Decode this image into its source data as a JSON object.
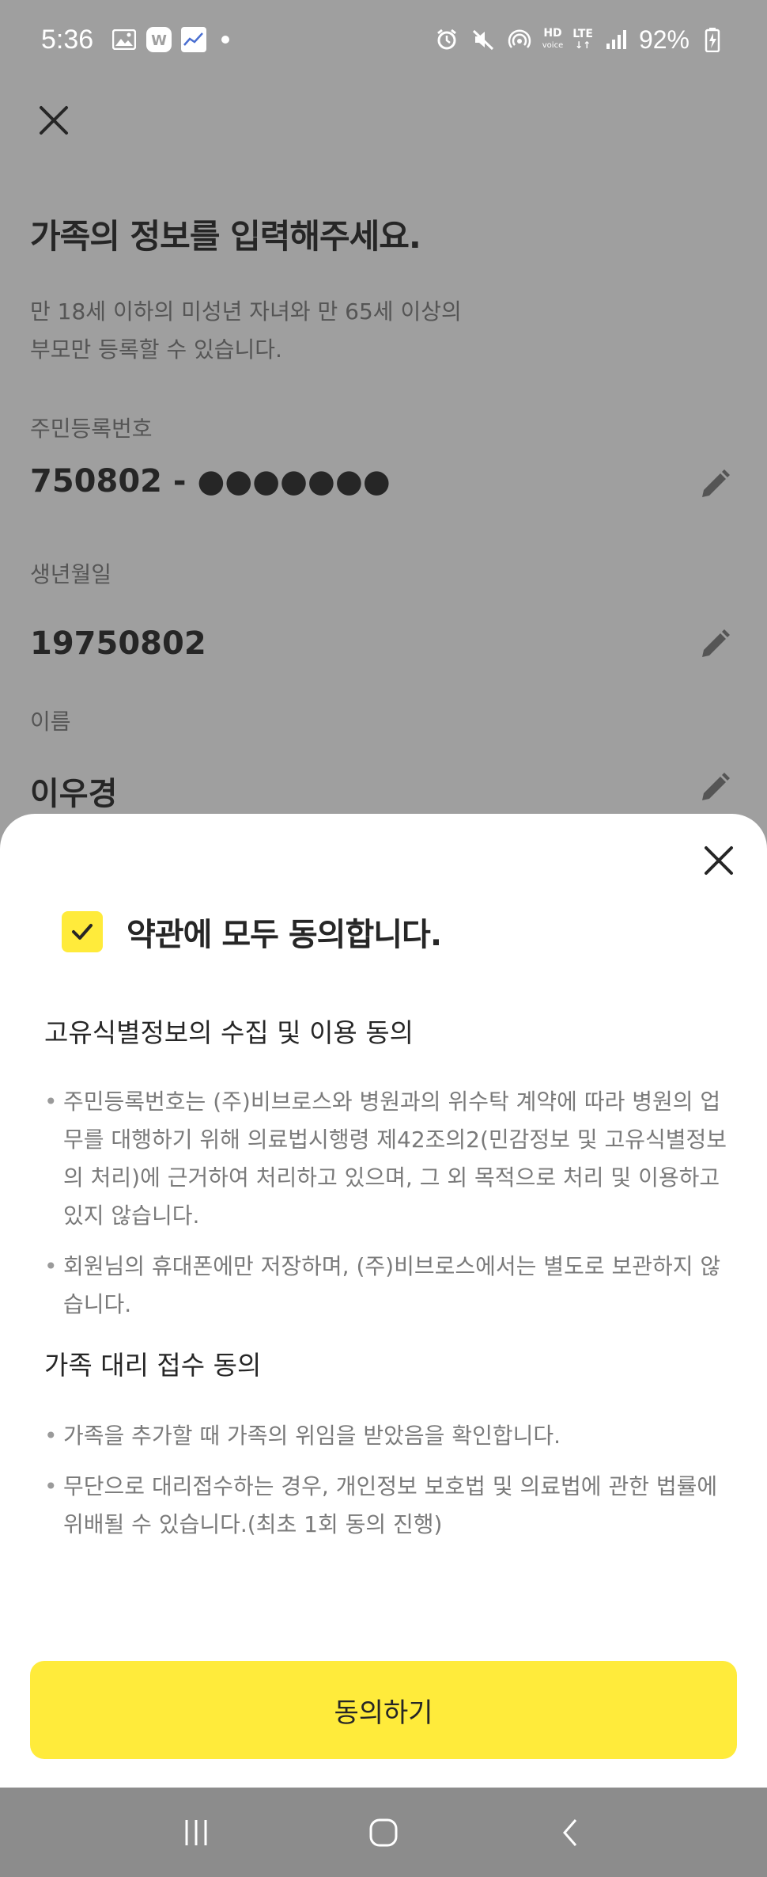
{
  "status_bar": {
    "time": "5:36",
    "battery": "92%",
    "hd_label": "HD",
    "hd_sub": "voice",
    "lte_label": "LTE"
  },
  "page": {
    "title": "가족의 정보를 입력해주세요.",
    "description_line1": "만 18세 이하의 미성년 자녀와 만 65세 이상의",
    "description_line2": "부모만 등록할 수 있습니다.",
    "fields": [
      {
        "label": "주민등록번호",
        "value": "750802 - ●●●●●●●"
      },
      {
        "label": "생년월일",
        "value": "19750802"
      },
      {
        "label": "이름",
        "value": "이우경"
      }
    ]
  },
  "sheet": {
    "agree_all_label": "약관에 모두 동의합니다.",
    "sections": [
      {
        "title": "고유식별정보의 수집 및 이용 동의",
        "bullets": [
          "주민등록번호는 (주)비브로스와 병원과의 위수탁 계약에 따라 병원의 업무를 대행하기 위해 의료법시행령 제42조의2(민감정보 및 고유식별정보의 처리)에 근거하여 처리하고 있으며, 그 외 목적으로 처리 및 이용하고 있지 않습니다.",
          "회원님의 휴대폰에만 저장하며, (주)비브로스에서는 별도로 보관하지 않습니다."
        ]
      },
      {
        "title": "가족 대리 접수 동의",
        "bullets": [
          "가족을 추가할 때 가족의 위임을 받았음을 확인합니다.",
          "무단으로 대리접수하는 경우, 개인정보 보호법 및 의료법에 관한 법률에 위배될 수 있습니다.(최초 1회 동의 진행)"
        ]
      }
    ],
    "agree_button_label": "동의하기"
  },
  "colors": {
    "accent_yellow": "#ffeb3b",
    "dim_background": "#9f9f9f"
  }
}
